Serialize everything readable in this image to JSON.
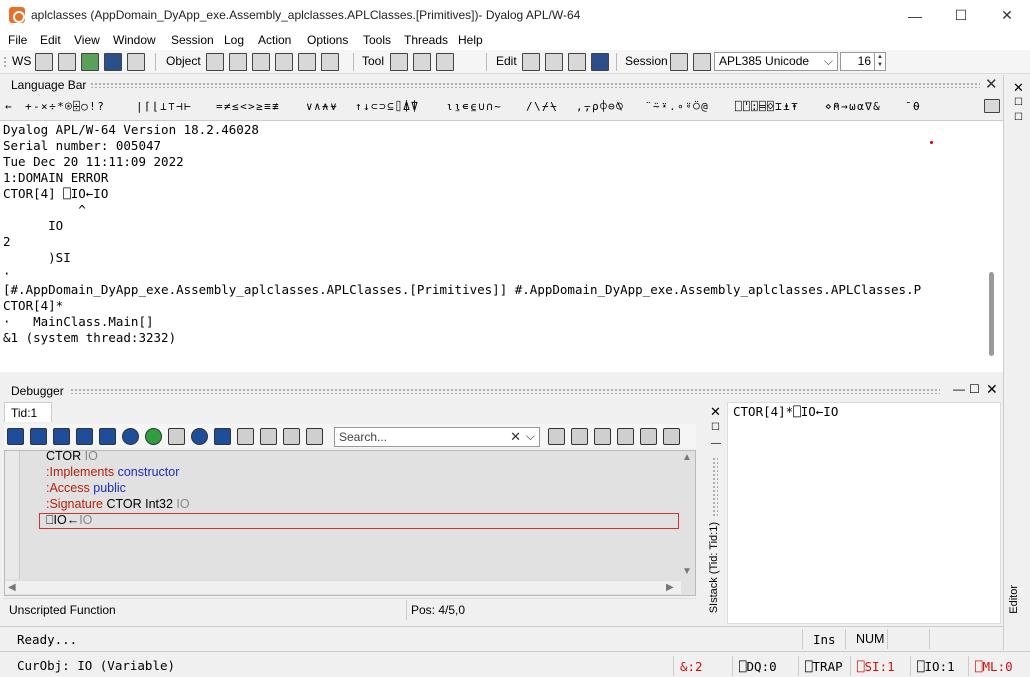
{
  "window": {
    "title": "aplclasses (AppDomain_DyApp_exe.Assembly_aplclasses.APLClasses.[Primitives])- Dyalog APL/W-64",
    "controls": {
      "minimize": "—",
      "maximize": "☐",
      "close": "✕"
    }
  },
  "menu": [
    "File",
    "Edit",
    "View",
    "Window",
    "Session",
    "Log",
    "Action",
    "Options",
    "Tools",
    "Threads",
    "Help"
  ],
  "toolbar": {
    "ws_label": "WS",
    "object_label": "Object",
    "tool_label": "Tool",
    "edit_label": "Edit",
    "session_label": "Session",
    "font_name": "APL385 Unicode",
    "font_size": "16"
  },
  "language_bar": {
    "title": "Language Bar",
    "groups": [
      "←",
      "+-×÷*⍟⌹○!?",
      "|⌈⌊⊥⊤⊣⊢",
      "=≠≤<>≥≡≢",
      "∨∧⍲⍱",
      "↑↓⊂⊃⊆⌷⍋⍒",
      "⍳⍸∊⍷∪∩~",
      "/\\⌿⍀",
      ",⍪⍴⌽⊖⍉",
      "¨⍨⍣.∘⍤⍥@",
      "⎕⍞⍠⌸⌺⌶⍎⍕",
      "⋄⍝→⍵⍺∇&",
      "¯⍬"
    ]
  },
  "session": {
    "lines": [
      "Dyalog APL/W-64 Version 18.2.46028",
      "Serial number: 005047",
      "Tue Dec 20 11:11:09 2022",
      "1:DOMAIN ERROR",
      "CTOR[4] ⎕IO←IO",
      "          ^",
      "      IO",
      "2",
      "      )SI",
      "·",
      "[#.AppDomain_DyApp_exe.Assembly_aplclasses.APLClasses.[Primitives]] #.AppDomain_DyApp_exe.Assembly_aplclasses.APLClasses.P",
      "CTOR[4]*",
      "·   MainClass.Main[]",
      "&1 (system thread:3232)"
    ]
  },
  "debugger": {
    "title": "Debugger",
    "tab": "Tid:1",
    "search_placeholder": "Search...",
    "code": [
      {
        "parts": [
          {
            "t": "CTOR ",
            "c": ""
          },
          {
            "t": "IO",
            "c": "gy"
          }
        ]
      },
      {
        "parts": [
          {
            "t": ":Implements ",
            "c": "kw"
          },
          {
            "t": "constructor",
            "c": "bl"
          }
        ]
      },
      {
        "parts": [
          {
            "t": ":Access ",
            "c": "kw"
          },
          {
            "t": "public",
            "c": "bl"
          }
        ]
      },
      {
        "parts": [
          {
            "t": ":Signature ",
            "c": "kw"
          },
          {
            "t": "CTOR Int32 ",
            "c": ""
          },
          {
            "t": "IO",
            "c": "gy"
          }
        ]
      },
      {
        "parts": [
          {
            "t": "⎕IO←",
            "c": ""
          },
          {
            "t": "IO",
            "c": "gy"
          }
        ]
      }
    ],
    "status_kind": "Unscripted Function",
    "status_pos": "Pos: 4/5,0"
  },
  "sistack": {
    "label": "SIstack (Tid: Tid:1)",
    "entries": [
      "CTOR[4]*⎕IO←IO"
    ]
  },
  "editor_tab": "Editor",
  "status": {
    "message": "Ready...",
    "ins": "Ins",
    "num": "NUM",
    "curobj": "CurObj: IO (Variable)",
    "indicators": [
      {
        "text": "&:2",
        "red": true
      },
      {
        "text": "⎕DQ:0",
        "red": false
      },
      {
        "text": "⎕TRAP",
        "red": false
      },
      {
        "text": "⎕SI:1",
        "red": true
      },
      {
        "text": "⎕IO:1",
        "red": false
      },
      {
        "text": "⎕ML:0",
        "red": true
      }
    ]
  }
}
